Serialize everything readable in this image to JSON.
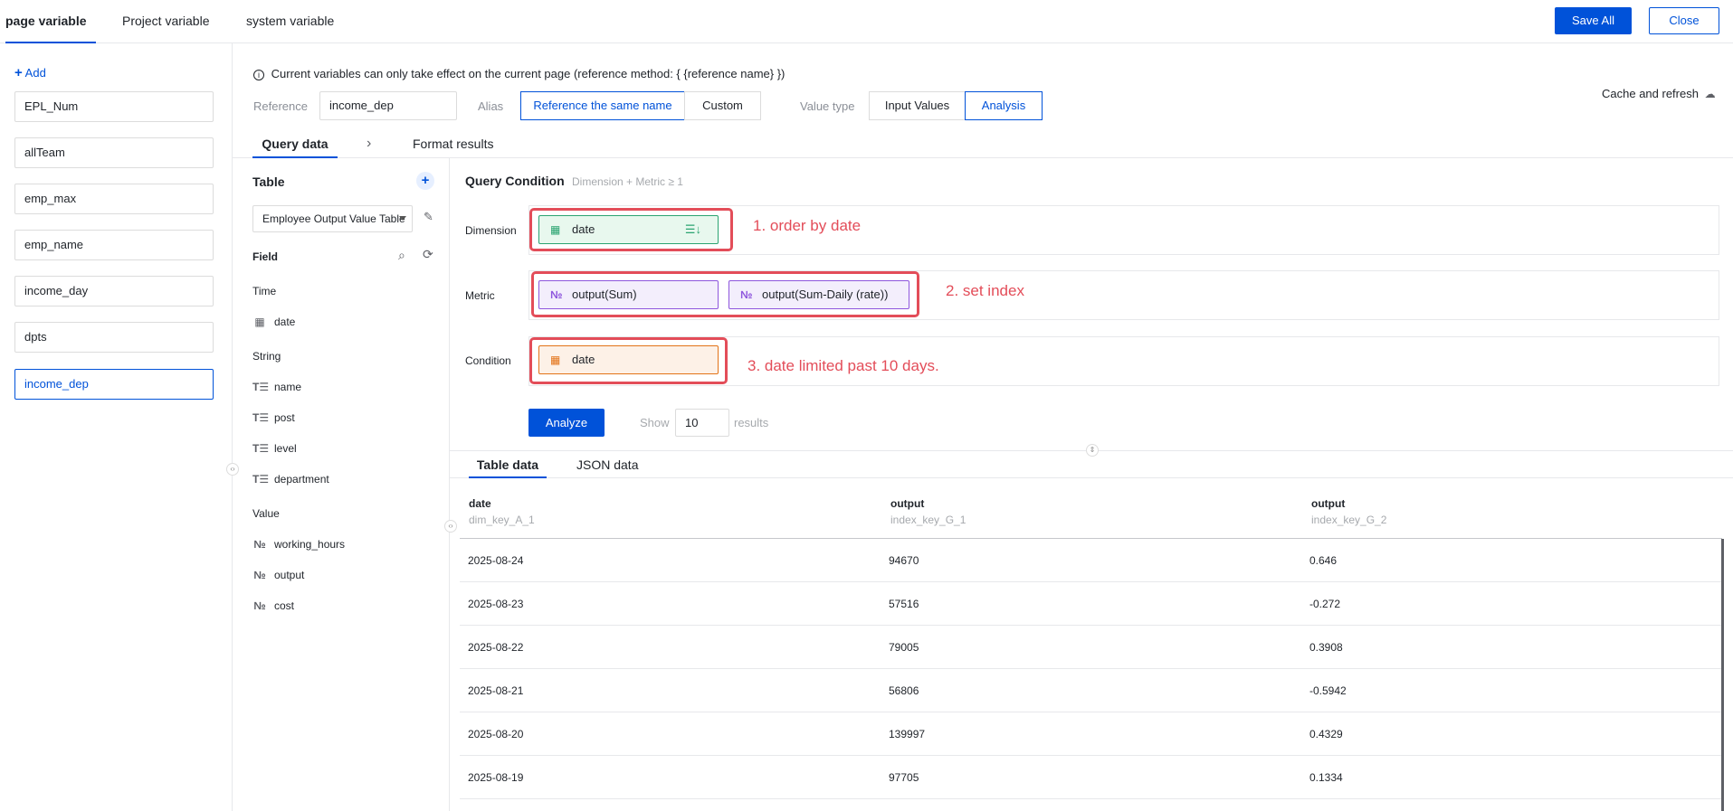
{
  "top_tabs": [
    "page variable",
    "Project variable",
    "system variable"
  ],
  "actions": {
    "save_all": "Save All",
    "close": "Close"
  },
  "sidebar": {
    "add_label": "Add",
    "variables": [
      "EPL_Num",
      "allTeam",
      "emp_max",
      "emp_name",
      "income_day",
      "dpts",
      "income_dep"
    ]
  },
  "header": {
    "info": "Current variables can only take effect on the current page (reference method: { {reference name} })",
    "reference_label": "Reference",
    "reference_value": "income_dep",
    "alias_label": "Alias",
    "alias_options": [
      "Reference the same name",
      "Custom"
    ],
    "value_type_label": "Value type",
    "value_type_options": [
      "Input Values",
      "Analysis"
    ],
    "cache_refresh": "Cache and refresh"
  },
  "sub_tabs": {
    "query": "Query data",
    "format": "Format results"
  },
  "table_panel": {
    "title": "Table",
    "selected_table": "Employee Output Value Table",
    "field_title": "Field",
    "groups": [
      {
        "name": "Time",
        "fields": [
          {
            "name": "date",
            "icon": "calendar-icon"
          }
        ]
      },
      {
        "name": "String",
        "fields": [
          {
            "name": "name",
            "icon": "text-icon"
          },
          {
            "name": "post",
            "icon": "text-icon"
          },
          {
            "name": "level",
            "icon": "text-icon"
          },
          {
            "name": "department",
            "icon": "text-icon"
          }
        ]
      },
      {
        "name": "Value",
        "fields": [
          {
            "name": "working_hours",
            "icon": "number-icon"
          },
          {
            "name": "output",
            "icon": "number-icon"
          },
          {
            "name": "cost",
            "icon": "number-icon"
          }
        ]
      }
    ]
  },
  "query": {
    "title": "Query Condition",
    "hint": "Dimension + Metric ≥ 1",
    "dimension_label": "Dimension",
    "dimension_chip": "date",
    "metric_label": "Metric",
    "metric_chips": [
      "output(Sum)",
      "output(Sum-Daily (rate))"
    ],
    "condition_label": "Condition",
    "condition_chip": "date",
    "annotations": [
      "1. order by date",
      "2. set index",
      "3. date limited past 10 days."
    ],
    "analyze_label": "Analyze",
    "show_label": "Show",
    "show_value": "10",
    "results_label": "results"
  },
  "results": {
    "tabs": [
      "Table data",
      "JSON data"
    ],
    "columns": [
      {
        "title": "date",
        "key": "dim_key_A_1"
      },
      {
        "title": "output",
        "key": "index_key_G_1"
      },
      {
        "title": "output",
        "key": "index_key_G_2"
      }
    ],
    "rows": [
      [
        "2025-08-24",
        "94670",
        "0.646"
      ],
      [
        "2025-08-23",
        "57516",
        "-0.272"
      ],
      [
        "2025-08-22",
        "79005",
        "0.3908"
      ],
      [
        "2025-08-21",
        "56806",
        "-0.5942"
      ],
      [
        "2025-08-20",
        "139997",
        "0.4329"
      ],
      [
        "2025-08-19",
        "97705",
        "0.1334"
      ]
    ]
  },
  "colors": {
    "primary": "#0052d9",
    "dimension": "#2ba471",
    "metric": "#8e56dd",
    "condition": "#e37318",
    "annotation": "#e34d59"
  }
}
